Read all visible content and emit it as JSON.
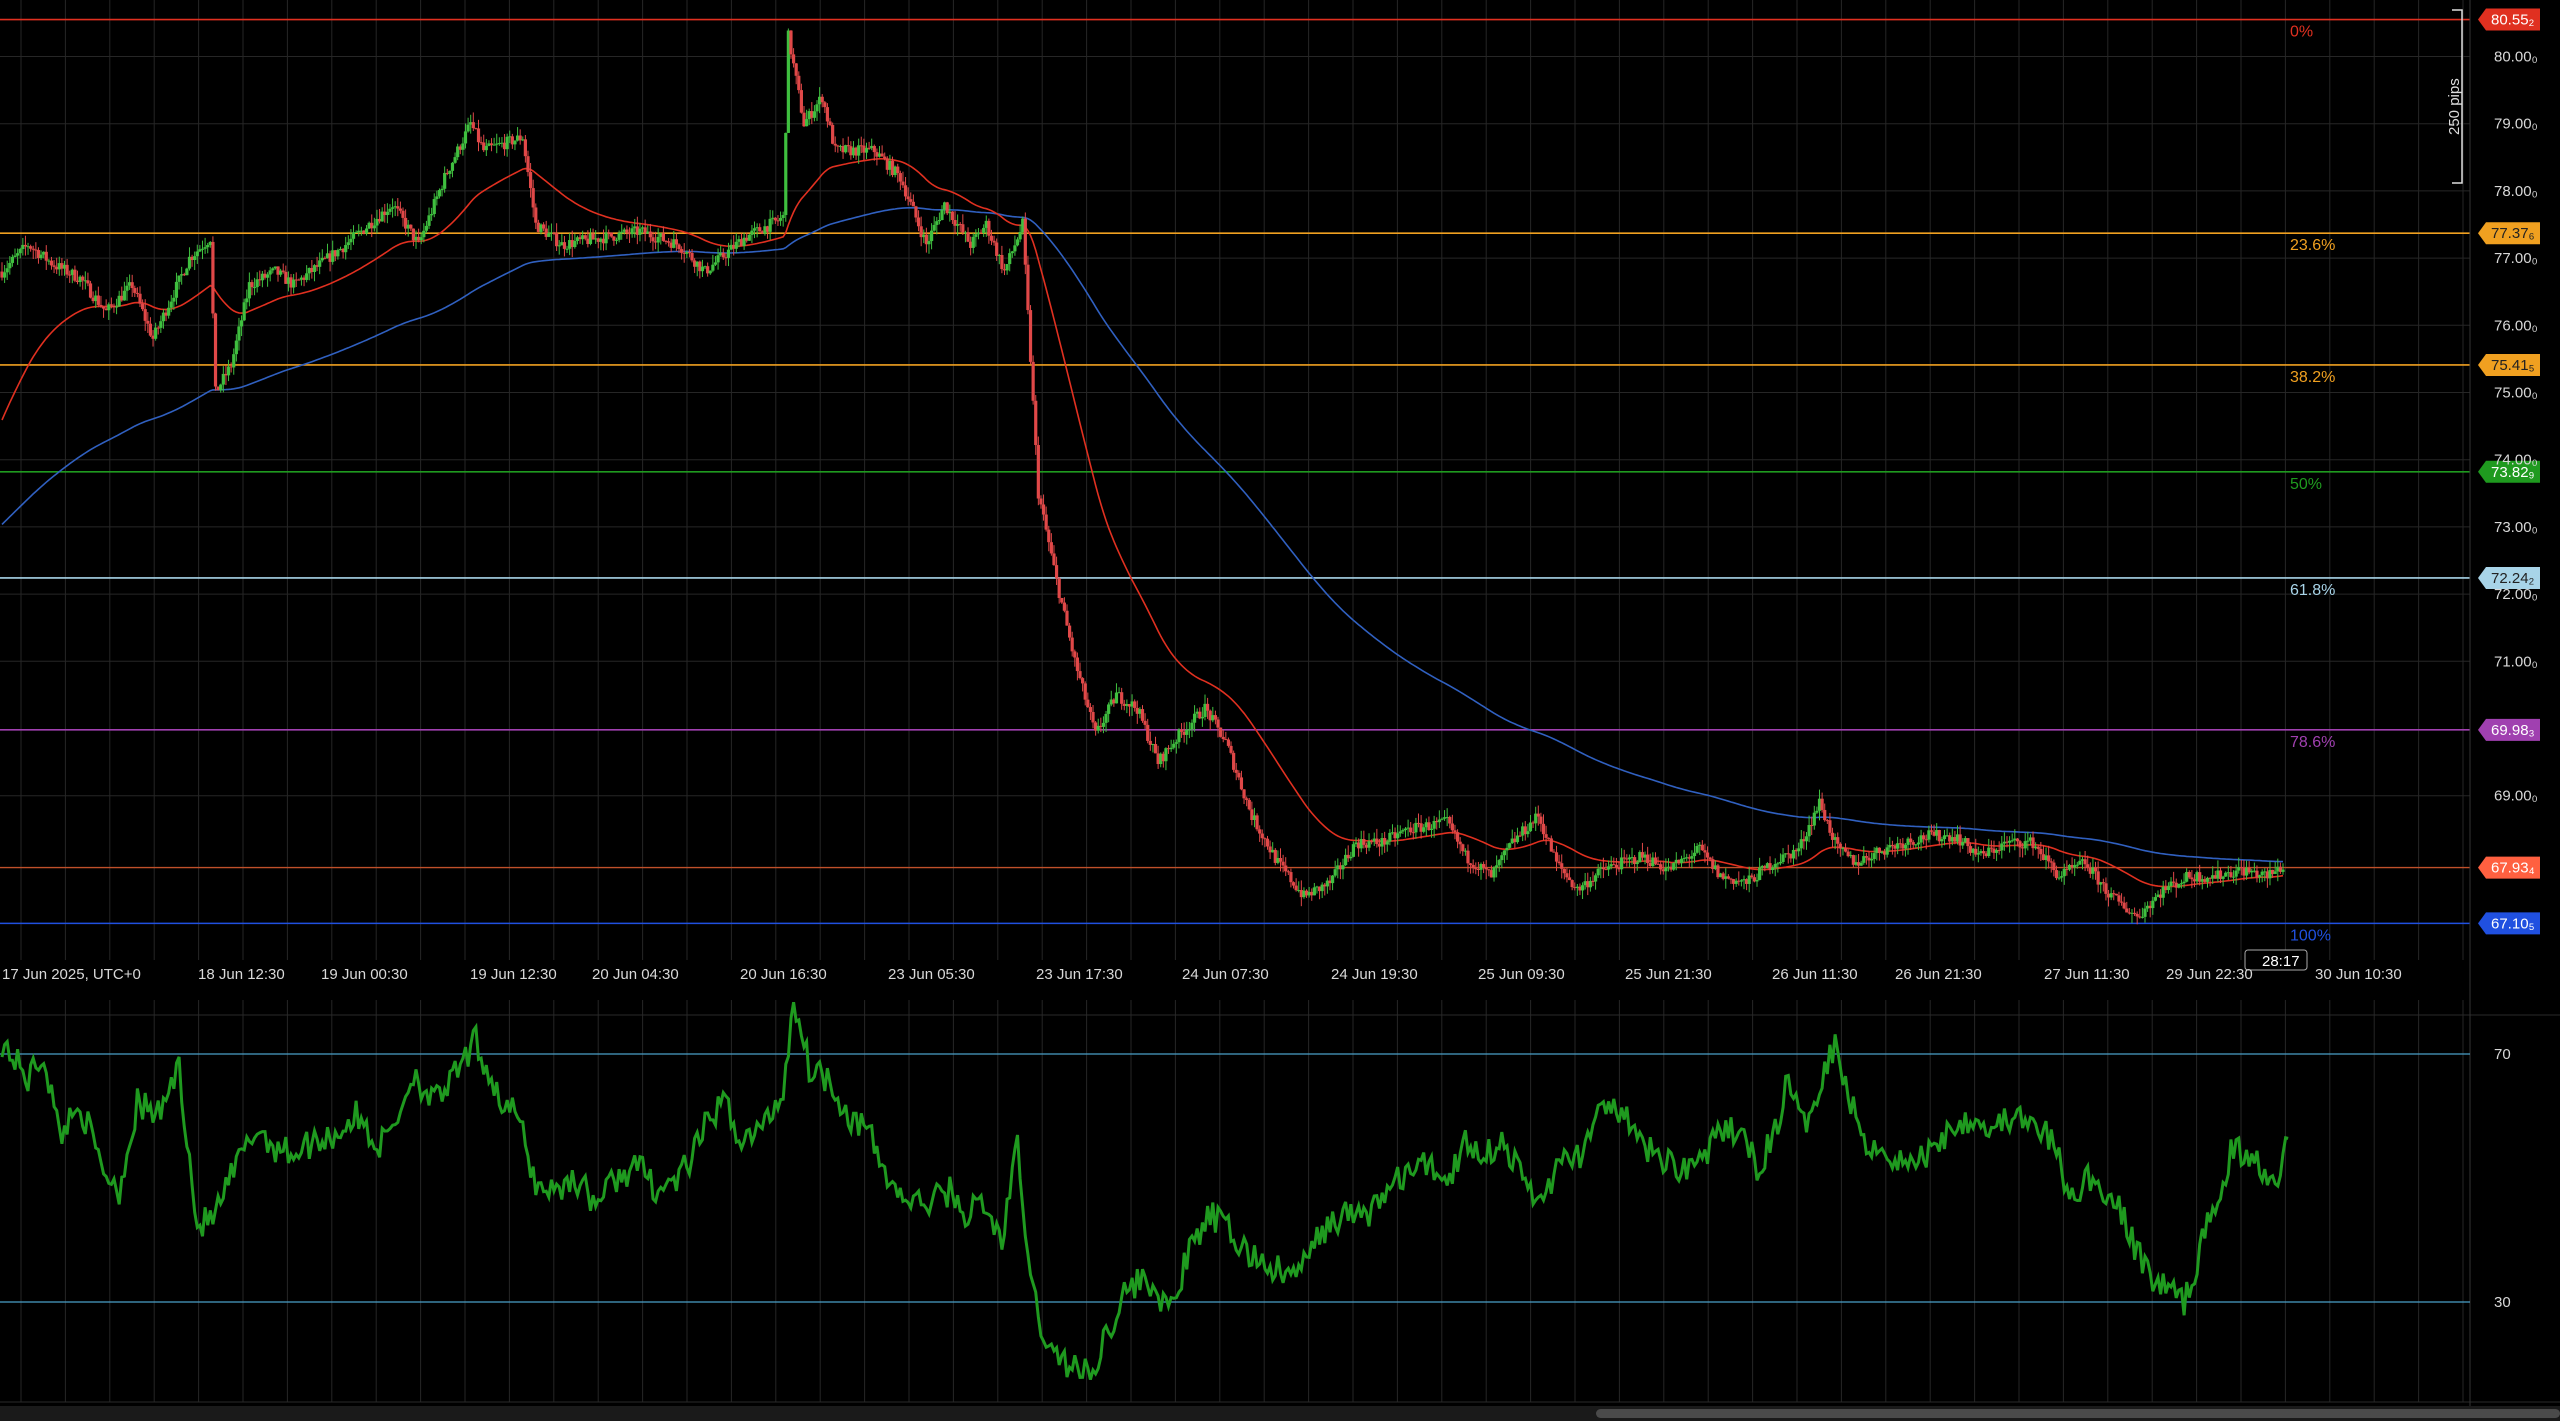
{
  "chart_data": [
    {
      "type": "candlestick",
      "ylim": [
        66.6,
        80.8
      ],
      "y_ticks": [
        "80.00",
        "79.00",
        "78.00",
        "77.00",
        "76.00",
        "75.00",
        "74.00",
        "73.00",
        "72.00",
        "71.00",
        "69.00"
      ],
      "x_labels": [
        "17 Jun 2025, UTC+0",
        "18 Jun 12:30",
        "19 Jun 00:30",
        "19 Jun 12:30",
        "20 Jun 04:30",
        "20 Jun 16:30",
        "23 Jun 05:30",
        "23 Jun 17:30",
        "24 Jun 07:30",
        "24 Jun 19:30",
        "25 Jun 09:30",
        "25 Jun 21:30",
        "26 Jun 11:30",
        "26 Jun 21:30",
        "27 Jun 11:30",
        "29 Jun 22:30",
        "30 Jun 10:30"
      ],
      "fib_levels": [
        {
          "label": "0%",
          "price": 80.55,
          "tag": "80.55₂",
          "color": "#e03020"
        },
        {
          "label": "23.6%",
          "price": 77.37,
          "tag": "77.37₆",
          "color": "#f0a020"
        },
        {
          "label": "38.2%",
          "price": 75.41,
          "tag": "75.41₅",
          "color": "#f0a020"
        },
        {
          "label": "50%",
          "price": 73.82,
          "tag": "73.82₉",
          "color": "#1f9a1f"
        },
        {
          "label": "61.8%",
          "price": 72.24,
          "tag": "72.24₂",
          "color": "#a8d4e8"
        },
        {
          "label": "78.6%",
          "price": 69.98,
          "tag": "69.98₃",
          "color": "#a040b0"
        },
        {
          "label": "100%",
          "price": 67.1,
          "tag": "67.10₅",
          "color": "#2050e0"
        }
      ],
      "current_price": {
        "tag": "67.93₄",
        "price": 67.93,
        "color": "#ff6040",
        "countdown": "28:17"
      },
      "measure_label": "250 pips",
      "ohlc_anchors": [
        [
          0,
          76.8
        ],
        [
          10,
          77.2
        ],
        [
          20,
          76.9
        ],
        [
          30,
          76.7
        ],
        [
          40,
          76.2
        ],
        [
          50,
          76.6
        ],
        [
          58,
          75.8
        ],
        [
          65,
          76.4
        ],
        [
          72,
          77.0
        ],
        [
          80,
          77.3
        ],
        [
          82,
          75.0
        ],
        [
          88,
          75.4
        ],
        [
          95,
          76.6
        ],
        [
          105,
          76.8
        ],
        [
          112,
          76.6
        ],
        [
          122,
          76.9
        ],
        [
          132,
          77.2
        ],
        [
          150,
          77.8
        ],
        [
          160,
          77.2
        ],
        [
          170,
          78.2
        ],
        [
          180,
          79.0
        ],
        [
          185,
          78.6
        ],
        [
          200,
          78.8
        ],
        [
          205,
          77.5
        ],
        [
          215,
          77.2
        ],
        [
          230,
          77.3
        ],
        [
          245,
          77.4
        ],
        [
          260,
          77.2
        ],
        [
          270,
          76.8
        ],
        [
          285,
          77.3
        ],
        [
          300,
          77.6
        ],
        [
          302,
          80.3
        ],
        [
          308,
          79.0
        ],
        [
          315,
          79.4
        ],
        [
          320,
          78.6
        ],
        [
          335,
          78.6
        ],
        [
          345,
          78.2
        ],
        [
          355,
          77.2
        ],
        [
          362,
          77.8
        ],
        [
          372,
          77.2
        ],
        [
          378,
          77.5
        ],
        [
          385,
          76.8
        ],
        [
          392,
          77.5
        ],
        [
          398,
          73.5
        ],
        [
          405,
          72.2
        ],
        [
          412,
          71.0
        ],
        [
          420,
          69.9
        ],
        [
          428,
          70.5
        ],
        [
          436,
          70.3
        ],
        [
          444,
          69.5
        ],
        [
          452,
          69.9
        ],
        [
          462,
          70.3
        ],
        [
          470,
          69.8
        ],
        [
          480,
          68.7
        ],
        [
          490,
          68.0
        ],
        [
          500,
          67.5
        ],
        [
          510,
          67.7
        ],
        [
          520,
          68.3
        ],
        [
          530,
          68.3
        ],
        [
          540,
          68.5
        ],
        [
          555,
          68.6
        ],
        [
          562,
          68.1
        ],
        [
          572,
          67.8
        ],
        [
          580,
          68.3
        ],
        [
          590,
          68.7
        ],
        [
          597,
          68.0
        ],
        [
          605,
          67.6
        ],
        [
          615,
          67.9
        ],
        [
          630,
          68.1
        ],
        [
          640,
          67.9
        ],
        [
          652,
          68.2
        ],
        [
          660,
          67.8
        ],
        [
          670,
          67.7
        ],
        [
          680,
          68.0
        ],
        [
          690,
          68.2
        ],
        [
          698,
          68.9
        ],
        [
          705,
          68.2
        ],
        [
          712,
          68.0
        ],
        [
          722,
          68.2
        ],
        [
          730,
          68.3
        ],
        [
          740,
          68.4
        ],
        [
          750,
          68.4
        ],
        [
          760,
          68.1
        ],
        [
          770,
          68.3
        ],
        [
          780,
          68.3
        ],
        [
          790,
          67.8
        ],
        [
          800,
          68.0
        ],
        [
          810,
          67.5
        ],
        [
          820,
          67.2
        ],
        [
          830,
          67.6
        ],
        [
          840,
          67.8
        ],
        [
          850,
          67.8
        ],
        [
          860,
          67.9
        ],
        [
          870,
          67.8
        ],
        [
          876,
          67.95
        ]
      ],
      "rsi": {
        "levels": [
          "70",
          "30"
        ],
        "level_values": [
          70,
          30
        ],
        "ylim": [
          15,
          80
        ],
        "color": "#1f9a1f",
        "anchors": [
          [
            0,
            72
          ],
          [
            10,
            66
          ],
          [
            16,
            70
          ],
          [
            22,
            57
          ],
          [
            30,
            62
          ],
          [
            38,
            52
          ],
          [
            45,
            48
          ],
          [
            52,
            62
          ],
          [
            60,
            60
          ],
          [
            68,
            68
          ],
          [
            75,
            42
          ],
          [
            82,
            44
          ],
          [
            90,
            52
          ],
          [
            98,
            58
          ],
          [
            105,
            55
          ],
          [
            112,
            54
          ],
          [
            120,
            56
          ],
          [
            128,
            57
          ],
          [
            136,
            60
          ],
          [
            145,
            55
          ],
          [
            152,
            60
          ],
          [
            158,
            67
          ],
          [
            166,
            62
          ],
          [
            175,
            67
          ],
          [
            182,
            72
          ],
          [
            188,
            66
          ],
          [
            192,
            62
          ],
          [
            198,
            60
          ],
          [
            205,
            49
          ],
          [
            212,
            48
          ],
          [
            220,
            50
          ],
          [
            228,
            46
          ],
          [
            236,
            50
          ],
          [
            244,
            52
          ],
          [
            252,
            48
          ],
          [
            260,
            50
          ],
          [
            266,
            54
          ],
          [
            272,
            60
          ],
          [
            278,
            62
          ],
          [
            284,
            56
          ],
          [
            292,
            58
          ],
          [
            300,
            64
          ],
          [
            304,
            79
          ],
          [
            310,
            68
          ],
          [
            318,
            66
          ],
          [
            325,
            60
          ],
          [
            332,
            58
          ],
          [
            340,
            50
          ],
          [
            348,
            46
          ],
          [
            356,
            46
          ],
          [
            364,
            48
          ],
          [
            370,
            44
          ],
          [
            376,
            46
          ],
          [
            384,
            40
          ],
          [
            390,
            55
          ],
          [
            395,
            33
          ],
          [
            402,
            22
          ],
          [
            410,
            20
          ],
          [
            418,
            18
          ],
          [
            425,
            26
          ],
          [
            432,
            32
          ],
          [
            440,
            34
          ],
          [
            448,
            28
          ],
          [
            456,
            38
          ],
          [
            464,
            44
          ],
          [
            470,
            42
          ],
          [
            478,
            38
          ],
          [
            486,
            36
          ],
          [
            494,
            34
          ],
          [
            500,
            36
          ],
          [
            508,
            42
          ],
          [
            516,
            44
          ],
          [
            524,
            44
          ],
          [
            532,
            48
          ],
          [
            540,
            51
          ],
          [
            548,
            52
          ],
          [
            556,
            50
          ],
          [
            562,
            56
          ],
          [
            570,
            54
          ],
          [
            576,
            56
          ],
          [
            584,
            50
          ],
          [
            590,
            46
          ],
          [
            598,
            52
          ],
          [
            606,
            54
          ],
          [
            614,
            60
          ],
          [
            620,
            62
          ],
          [
            628,
            56
          ],
          [
            634,
            54
          ],
          [
            642,
            52
          ],
          [
            650,
            52
          ],
          [
            658,
            56
          ],
          [
            666,
            58
          ],
          [
            674,
            52
          ],
          [
            680,
            56
          ],
          [
            686,
            66
          ],
          [
            692,
            58
          ],
          [
            700,
            68
          ],
          [
            704,
            72
          ],
          [
            710,
            62
          ],
          [
            716,
            56
          ],
          [
            724,
            54
          ],
          [
            732,
            52
          ],
          [
            740,
            54
          ],
          [
            748,
            58
          ],
          [
            756,
            60
          ],
          [
            764,
            58
          ],
          [
            772,
            60
          ],
          [
            780,
            58
          ],
          [
            788,
            56
          ],
          [
            794,
            46
          ],
          [
            800,
            50
          ],
          [
            808,
            48
          ],
          [
            814,
            44
          ],
          [
            820,
            38
          ],
          [
            826,
            34
          ],
          [
            832,
            32
          ],
          [
            838,
            30
          ],
          [
            844,
            38
          ],
          [
            850,
            46
          ],
          [
            856,
            54
          ],
          [
            862,
            54
          ],
          [
            868,
            52
          ],
          [
            874,
            50
          ],
          [
            878,
            58
          ]
        ]
      },
      "ema_fast": {
        "color": "#e03020"
      },
      "ema_slow": {
        "color": "#3060c0"
      }
    }
  ]
}
